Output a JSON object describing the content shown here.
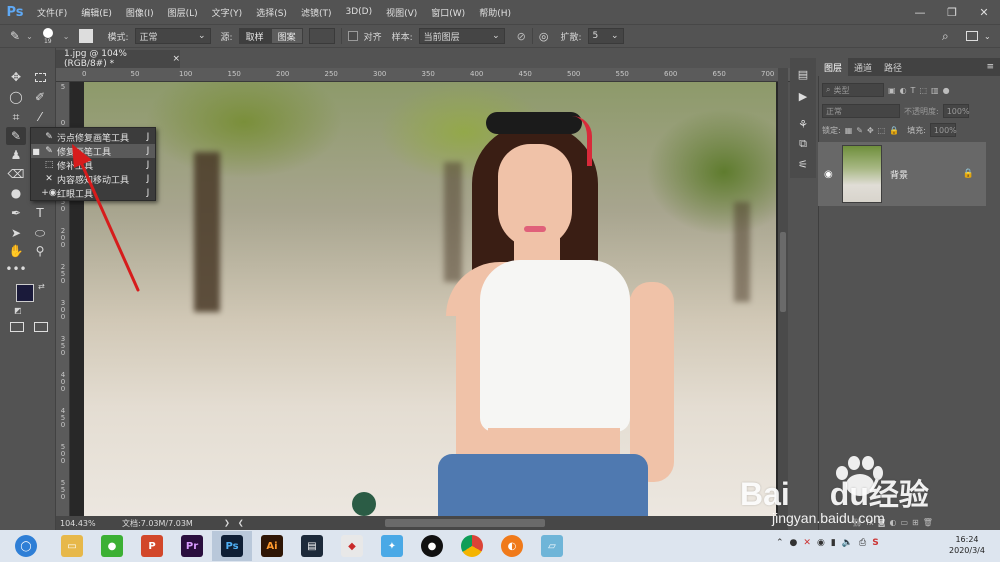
{
  "app": {
    "logo": "Ps"
  },
  "menu": [
    "文件(F)",
    "编辑(E)",
    "图像(I)",
    "图层(L)",
    "文字(Y)",
    "选择(S)",
    "滤镜(T)",
    "3D(D)",
    "视图(V)",
    "窗口(W)",
    "帮助(H)"
  ],
  "window_controls": {
    "minimize": "—",
    "restore": "❐",
    "close": "✕"
  },
  "options": {
    "brush_size": "19",
    "mode_label": "模式:",
    "mode_value": "正常",
    "source_label": "源:",
    "sample_btn": "取样",
    "pattern_btn": "图案",
    "align_label": "对齐",
    "sample_label": "样本:",
    "sample_value": "当前图层",
    "diffusion_label": "扩散:",
    "diffusion_value": "5"
  },
  "document": {
    "tab_title": "1.jpg @ 104%(RGB/8#) *",
    "close": "×",
    "zoom": "104.43%",
    "doc_info": "文档:7.03M/7.03M"
  },
  "ruler_top": [
    "0",
    "50",
    "100",
    "150",
    "200",
    "250",
    "300",
    "350",
    "400",
    "450",
    "500",
    "550",
    "600",
    "650",
    "700"
  ],
  "ruler_left": [
    "5",
    "0",
    "1 0 0",
    "1 5 0",
    "2 0 0",
    "2 5 0",
    "3 0 0",
    "3 5 0",
    "4 0 0",
    "4 5 0",
    "5 0 0",
    "5 5 0"
  ],
  "flyout": [
    {
      "label": "污点修复画笔工具",
      "key": "J",
      "icon": "spot-healing-brush-icon",
      "selected": false
    },
    {
      "label": "修复画笔工具",
      "key": "J",
      "icon": "healing-brush-icon",
      "selected": true
    },
    {
      "label": "修补工具",
      "key": "J",
      "icon": "patch-icon",
      "selected": false
    },
    {
      "label": "内容感知移动工具",
      "key": "J",
      "icon": "content-aware-move-icon",
      "selected": false
    },
    {
      "label": "红眼工具",
      "key": "J",
      "icon": "red-eye-icon",
      "selected": false
    }
  ],
  "panel": {
    "tabs": [
      "图层",
      "通道",
      "路径"
    ],
    "kind_label": "类型",
    "blend_mode": "正常",
    "opacity_label": "不透明度:",
    "opacity_value": "100%",
    "lock_label": "锁定:",
    "fill_label": "填充:",
    "fill_value": "100%",
    "layer_name": "背景"
  },
  "taskbar": {
    "apps": [
      "browser",
      "explorer",
      "wechat",
      "powerpoint",
      "premiere",
      "photoshop",
      "illustrator",
      "video",
      "office",
      "bird",
      "qq",
      "chrome",
      "app",
      "notes"
    ],
    "time": "16:24",
    "date": "2020/3/4"
  },
  "watermark": {
    "brand": "Bai",
    "brand2": "du",
    "cn": "经验",
    "url": "jingyan.baidu.com"
  },
  "colors": {
    "ps_blue": "#5fa9f5",
    "annotation_arrow": "#d61c1c",
    "foreground": "#1a1a3a",
    "background": "#ffffff"
  }
}
